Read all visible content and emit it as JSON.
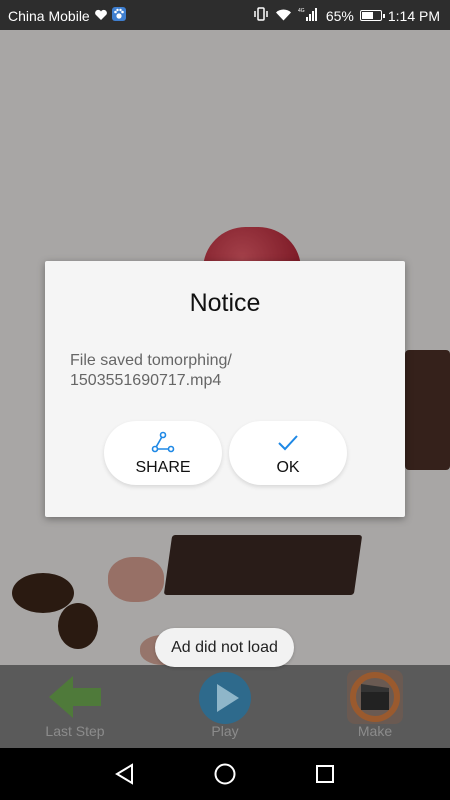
{
  "status_bar": {
    "carrier": "China Mobile",
    "network_label": "4G",
    "battery_percent": "65%",
    "battery_level": 0.65,
    "time": "1:14 PM"
  },
  "dialog": {
    "title": "Notice",
    "message_line1": "File saved tomorphing/",
    "message_line2": "1503551690717.mp4",
    "share_label": "SHARE",
    "ok_label": "OK",
    "accent_color": "#1e88e5"
  },
  "toast": {
    "text": "Ad did not load"
  },
  "toolbar": {
    "last_step_label": "Last Step",
    "play_label": "Play",
    "make_label": "Make"
  },
  "icons": {
    "status": [
      "heart-icon",
      "paw-icon",
      "vibrate-icon",
      "wifi-icon",
      "signal-icon",
      "battery-icon"
    ],
    "dialog": [
      "share-icon",
      "check-icon"
    ],
    "toolbar": [
      "arrow-left-icon",
      "play-icon",
      "clapperboard-icon"
    ],
    "nav": [
      "back-icon",
      "home-icon",
      "recent-apps-icon"
    ]
  }
}
